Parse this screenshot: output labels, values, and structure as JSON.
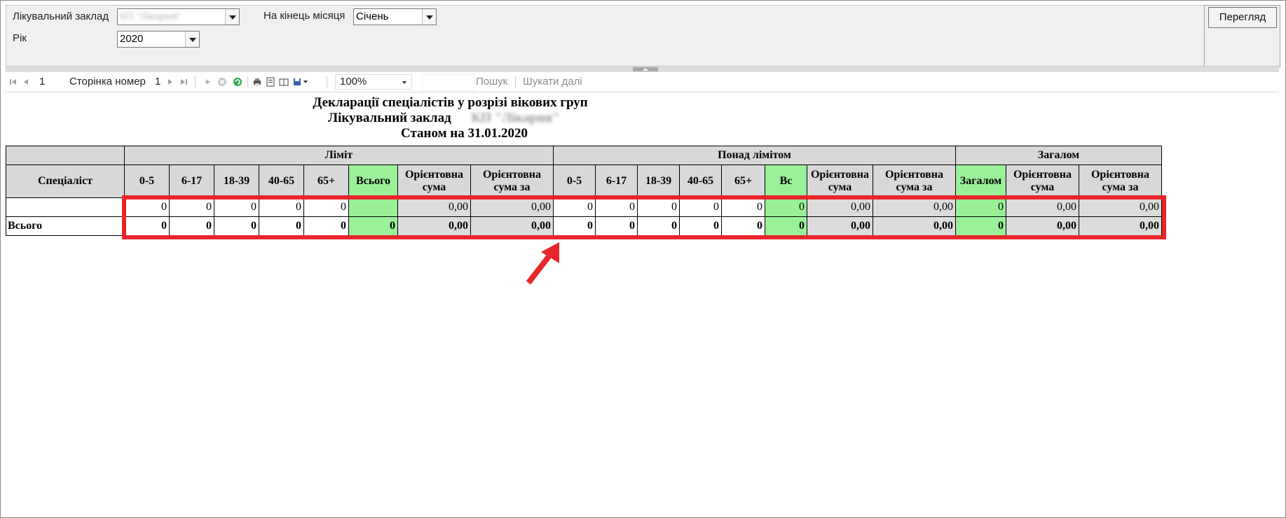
{
  "params": {
    "facility_label": "Лікувальний заклад",
    "facility_value": "КП \"Лікарня\"",
    "month_label": "На кінець місяця",
    "month_value": "Січень",
    "year_label": "Рік",
    "year_value": "2020",
    "view_button": "Перегляд"
  },
  "toolbar": {
    "page_current": "1",
    "page_label": "Сторінка номер",
    "page_number": "1",
    "zoom": "100%",
    "search_label": "Пошук",
    "find_next_label": "Шукати далі",
    "icons": [
      "first-page-icon",
      "prev-page-icon",
      "next-page-icon",
      "last-page-icon",
      "back-icon",
      "stop-icon",
      "refresh-icon",
      "print-icon",
      "page-layout-icon",
      "page-setup-icon",
      "export-icon"
    ]
  },
  "report": {
    "title": "Декларації спеціалістів у розрізі вікових груп",
    "facility_label": "Лікувальний заклад",
    "facility_value": "КП \"Лікарня\"",
    "as_of": "Станом на 31.01.2020",
    "groups": {
      "limit": "Ліміт",
      "over_limit": "Понад лімітом",
      "total": "Загалом"
    },
    "columns": {
      "specialist": "Спеціаліст",
      "limit": [
        "0-5",
        "6-17",
        "18-39",
        "40-65",
        "65+",
        "Всього",
        "Орієнтовна сума",
        "Орієнтовна сума за"
      ],
      "over": [
        "0-5",
        "6-17",
        "18-39",
        "40-65",
        "65+",
        "Вс",
        "Орієнтовна сума",
        "Орієнтовна сума за"
      ],
      "total": [
        "Загалом",
        "Орієнтовна сума",
        "Орієнтовна сума за"
      ]
    },
    "rows": [
      {
        "label": "",
        "limit": [
          "0",
          "0",
          "0",
          "0",
          "0",
          "",
          "0,00",
          "0,00"
        ],
        "over": [
          "0",
          "0",
          "0",
          "0",
          "0",
          "0",
          "0,00",
          "0,00"
        ],
        "total": [
          "0",
          "0,00",
          "0,00"
        ]
      },
      {
        "label": "Всього",
        "limit": [
          "0",
          "0",
          "0",
          "0",
          "0",
          "0",
          "0,00",
          "0,00"
        ],
        "over": [
          "0",
          "0",
          "0",
          "0",
          "0",
          "0",
          "0,00",
          "0,00"
        ],
        "total": [
          "0",
          "0,00",
          "0,00"
        ]
      }
    ]
  },
  "annotation": {
    "highlight_color": "#e8262b",
    "fill_green": "#99f099",
    "fill_gray": "#dcdcdc"
  }
}
